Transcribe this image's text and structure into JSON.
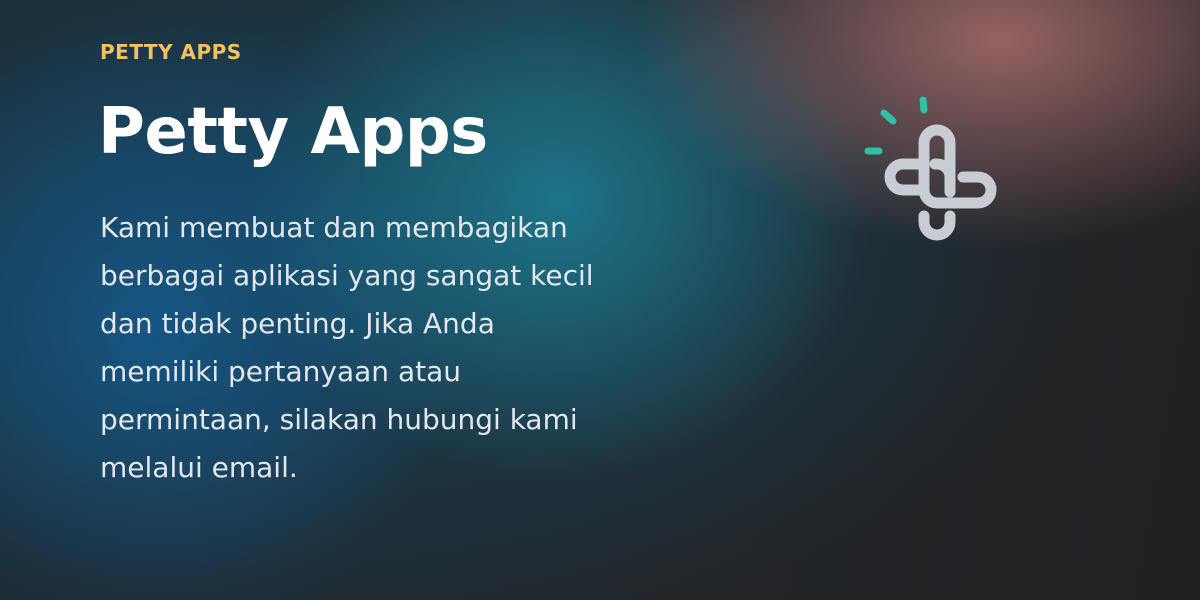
{
  "hero": {
    "eyebrow": "PETTY APPS",
    "title": "Petty Apps",
    "description": "Kami membuat dan membagikan berbagai aplikasi yang sangat kecil dan tidak penting. Jika Anda memiliki pertanyaan atau permintaan, silakan hubungi kami melalui email."
  },
  "logo": {
    "icon": "petty-apps-logo-icon",
    "colors": {
      "stroke": "#c8ccd3",
      "accent": "#2fc0a6"
    }
  },
  "colors": {
    "eyebrow": "#f2c25d",
    "title": "#ffffff",
    "body_text": "#e3e7ec"
  }
}
